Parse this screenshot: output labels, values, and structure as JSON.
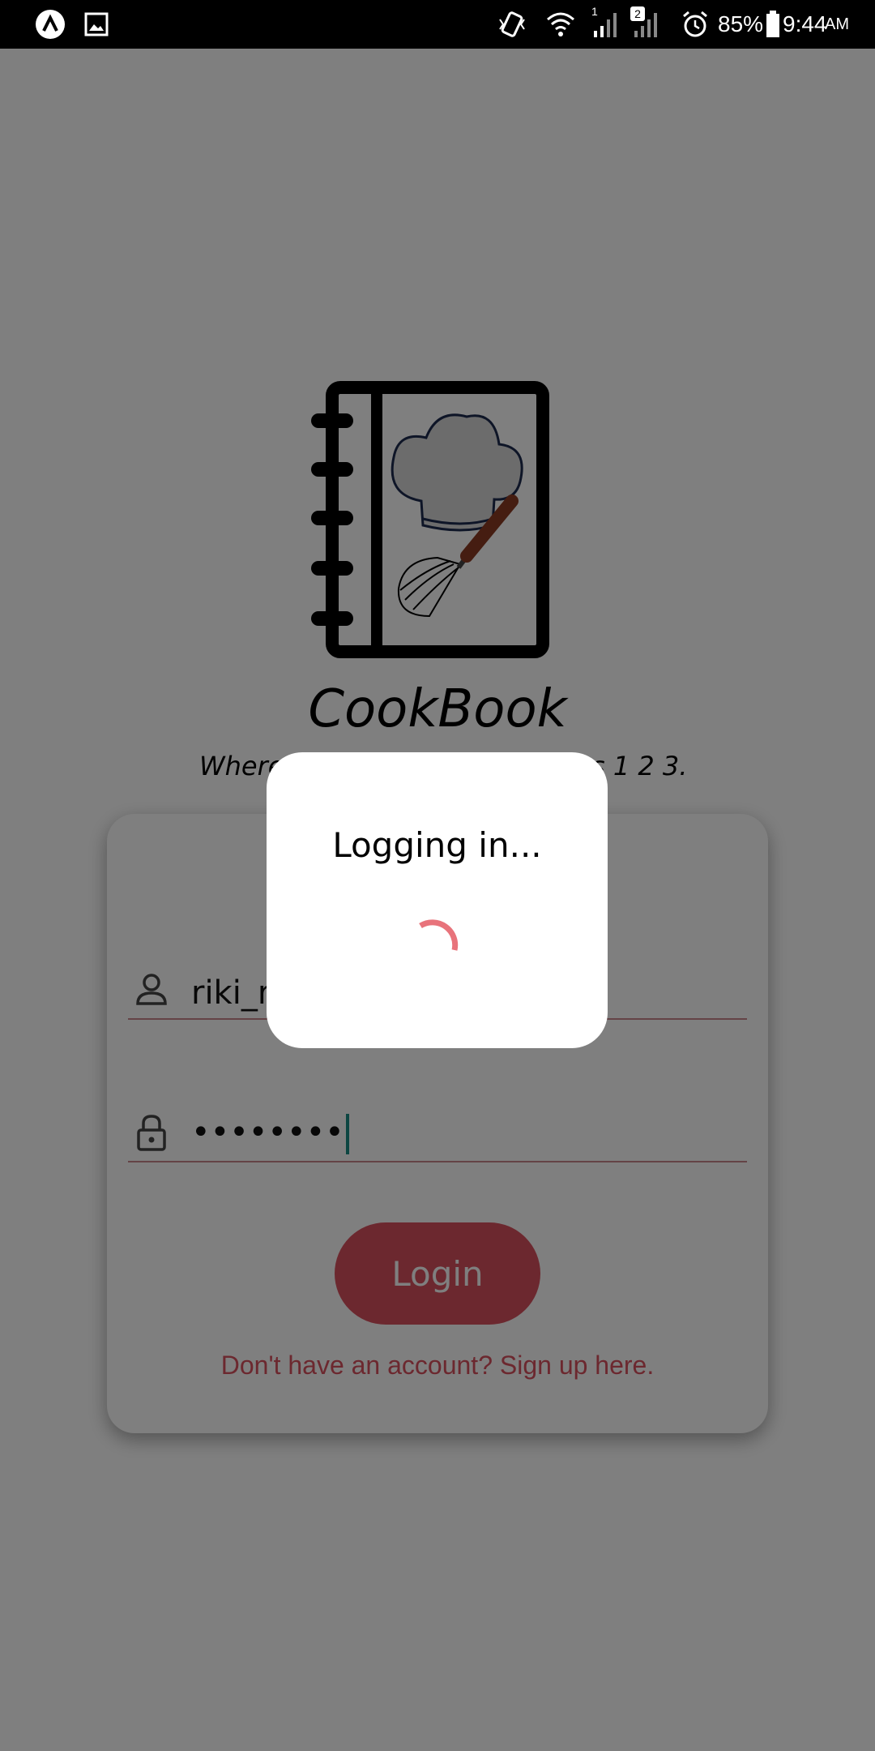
{
  "status_bar": {
    "battery_percent": "85%",
    "time": "9:44",
    "time_suffix": "AM",
    "sim2_badge": "2",
    "sim1_badge": "1",
    "icons": [
      "app-notification-icon",
      "image-icon",
      "vibrate-icon",
      "wifi-icon",
      "signal-1-icon",
      "signal-2-icon",
      "alarm-icon",
      "battery-icon"
    ]
  },
  "app": {
    "title": "CookBook",
    "tagline_left": "Where",
    "tagline_right": "s 1 2 3."
  },
  "login_form": {
    "username_value": "riki_r",
    "password_value": "••••••••",
    "login_label": "Login",
    "signup_text": "Don't have an account? Sign up here."
  },
  "dialog": {
    "title": "Logging in..."
  },
  "colors": {
    "accent": "#d9515e",
    "caret": "#1a8c84",
    "spinner": "#e8737b"
  }
}
